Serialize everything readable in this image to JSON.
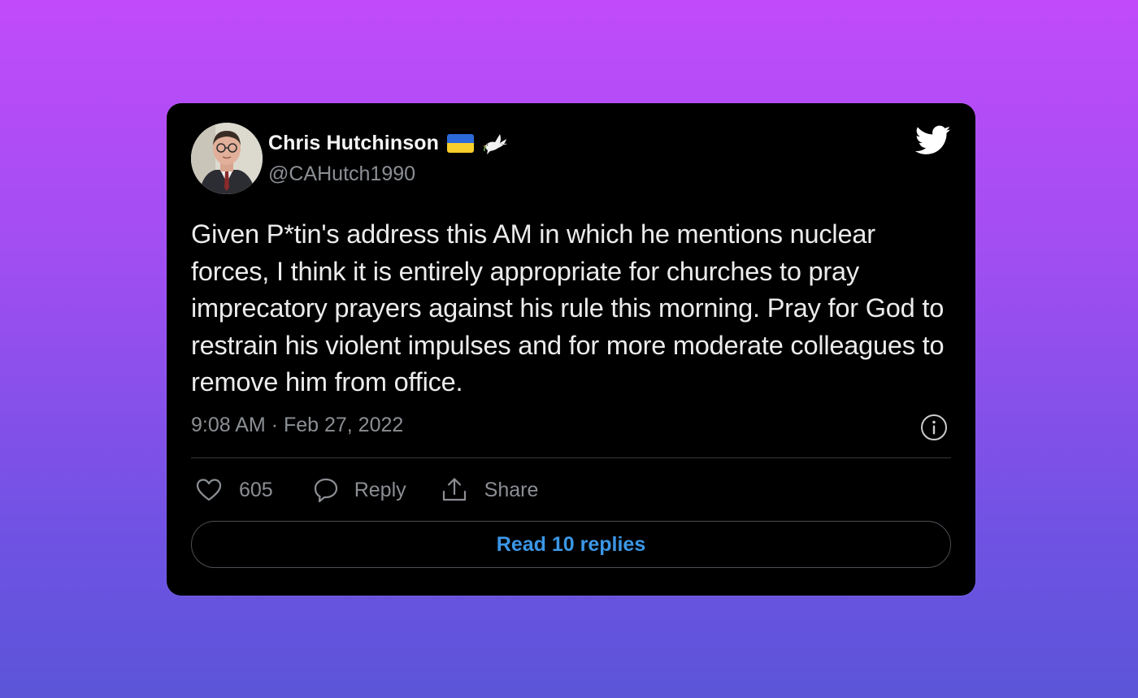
{
  "tweet": {
    "author": {
      "display_name": "Chris Hutchinson",
      "handle": "@CAHutch1990"
    },
    "text": "Given P*tin's address this AM in which he mentions nuclear forces, I think it is entirely appropriate for churches to pray imprecatory prayers against his rule this morning. Pray for God to restrain his violent impulses and for more moderate colleagues to remove him from office.",
    "timestamp": "9:08 AM · Feb 27, 2022",
    "likes": "605",
    "reply_label": "Reply",
    "share_label": "Share",
    "read_replies_label": "Read 10 replies"
  },
  "icons": {
    "flag": "ukraine-flag-icon",
    "dove": "dove-icon",
    "brand": "twitter-bird-icon",
    "info": "info-icon",
    "like": "heart-icon",
    "reply": "speech-bubble-icon",
    "share": "share-icon"
  },
  "colors": {
    "card_background": "#000000",
    "primary_text": "#ececec",
    "secondary_text": "#8b8f94",
    "link_accent": "#3b97e6",
    "divider": "#34373b",
    "background_gradient_top": "#c14bfb",
    "background_gradient_bottom": "#5b55d8"
  }
}
